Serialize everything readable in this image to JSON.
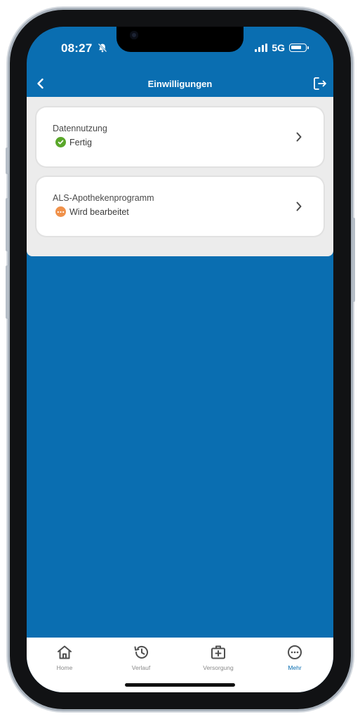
{
  "status_bar": {
    "time": "08:27",
    "network": "5G",
    "battery_level": 0.8
  },
  "nav": {
    "title": "Einwilligungen",
    "back_icon": "chevron-left-icon",
    "logout_icon": "logout-icon"
  },
  "consents": [
    {
      "title": "Datennutzung",
      "status": "Fertig",
      "status_icon": "check-circle-icon",
      "status_color": "#5aa72a"
    },
    {
      "title": "ALS-Apothekenprogramm",
      "status": "Wird bearbeitet",
      "status_icon": "more-dots-icon",
      "status_color": "#f0914a"
    }
  ],
  "tabs": [
    {
      "label": "Home",
      "icon": "home-icon",
      "active": false
    },
    {
      "label": "Verlauf",
      "icon": "history-icon",
      "active": false
    },
    {
      "label": "Versorgung",
      "icon": "medical-kit-icon",
      "active": false
    },
    {
      "label": "Mehr",
      "icon": "more-icon",
      "active": true
    }
  ],
  "colors": {
    "primary": "#0a6eb1",
    "panel": "#ececec",
    "inactive_tab": "#8a8a8a"
  }
}
